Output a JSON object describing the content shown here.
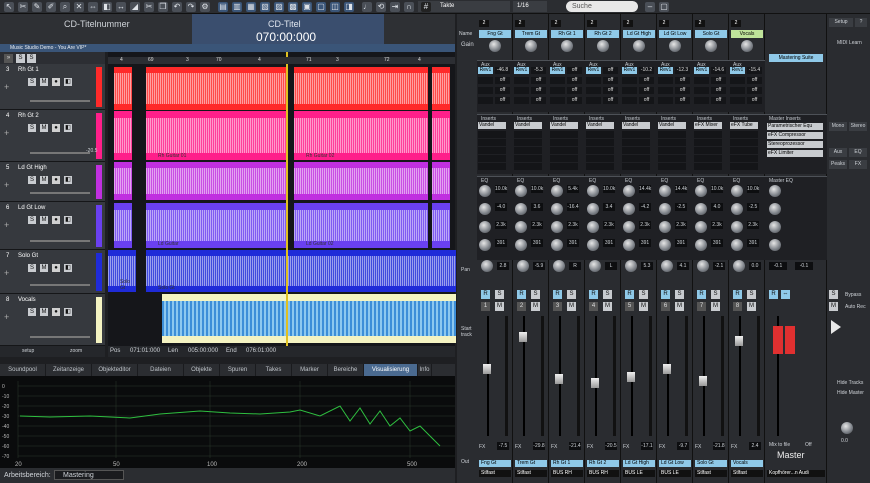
{
  "toolbar": {
    "tempo_label": "Takte",
    "grid": "1/16",
    "search_placeholder": "Suche"
  },
  "cd": {
    "track_label": "CD-Titelnummer",
    "title_label": "CD-Titel",
    "time": "070:00:000"
  },
  "project": {
    "name": "Music Studio Demo - You Are VIP*"
  },
  "tracks": [
    {
      "num": "3",
      "name": "Rh Gt 1",
      "color": "#ff2a2a"
    },
    {
      "num": "4",
      "name": "Rh Gt 2",
      "color": "#ff1f8a"
    },
    {
      "num": "5",
      "name": "Ld Gt High",
      "color": "#c030e0"
    },
    {
      "num": "6",
      "name": "Ld Gt Low",
      "color": "#6a40f0"
    },
    {
      "num": "7",
      "name": "Solo Gt",
      "color": "#1f2bd8"
    },
    {
      "num": "8",
      "name": "Vocals",
      "color": "#f4f3c2"
    }
  ],
  "track_btn": {
    "s": "S",
    "m": "M"
  },
  "track_vol": "-20.5",
  "ruler": {
    "marks": [
      "4",
      "69",
      "3",
      "70",
      "4",
      "71",
      "3",
      "72",
      "4"
    ]
  },
  "clips": {
    "rh_guitar": "Rh Guitar 01",
    "rh_guitar2": "Rh Guitar 02",
    "ld_guitar": "Ld Guitar",
    "ld_guitar2": "Ld Guitar 02",
    "solo": "Solo Gt",
    "solo2": "Solo Gt"
  },
  "zoom": {
    "setup": "setup",
    "zoom": "zoom"
  },
  "position": {
    "pos_label": "Pos",
    "pos_val": "071:01:000",
    "len_label": "Len",
    "len_val": "005:00:000",
    "end_label": "End",
    "end_val": "076:01:000"
  },
  "tabs": [
    "Soundpool",
    "Zeitanzeige",
    "Objekteditor",
    "Dateien",
    "Objekte",
    "Spuren",
    "Takes",
    "Marker",
    "Bereiche",
    "Visualisierung",
    "Info"
  ],
  "viz": {
    "x_ticks": [
      "20",
      "50",
      "100",
      "200",
      "500"
    ],
    "y_ticks": [
      "0",
      "-10",
      "-20",
      "-30",
      "-40",
      "-50",
      "-60",
      "-70"
    ]
  },
  "status": {
    "label": "Arbeitsbereich:",
    "value": "Mastering"
  },
  "mixer": {
    "name_label": "Name",
    "gain_label": "Gain",
    "aux_label": "Aux",
    "inserts_label": "Inserts",
    "eq_label": "EQ",
    "pan_label": "Pan",
    "start_label": "Start track",
    "out_label": "Out",
    "fx_label": "FX",
    "channels": [
      {
        "name": "Fng Gt",
        "vol": "-7.5",
        "out": "Stlfast",
        "pan": "2.8",
        "eq1": "10.0k",
        "eq2": "-4.0",
        "eq3": "2.3k",
        "eq4": "391",
        "aux1": "-46.8",
        "aux_sel": "Rev1",
        "out_num": "1"
      },
      {
        "name": "Trem Gt",
        "vol": "-29.8",
        "out": "Stlfast",
        "pan": "-5.9",
        "eq1": "10.0k",
        "eq2": "3.6",
        "eq3": "2.3k",
        "eq4": "391",
        "aux1": "-5.3",
        "aux_sel": "Rev1",
        "out_num": "2"
      },
      {
        "name": "Rh Gt 1",
        "vol": "-21.4",
        "out": "BUS RH",
        "pan": "R",
        "eq1": "5.4k",
        "eq2": "-16.4",
        "eq3": "2.3k",
        "eq4": "391",
        "aux1": "off",
        "aux_sel": "Rev1",
        "out_num": "3"
      },
      {
        "name": "Rh Gt 2",
        "vol": "-20.5",
        "out": "BUS RH",
        "pan": "L",
        "eq1": "10.0k",
        "eq2": "3.4",
        "eq3": "2.3k",
        "eq4": "391",
        "aux1": "off",
        "aux_sel": "Rev1",
        "out_num": "4"
      },
      {
        "name": "Ld Gt High",
        "vol": "-17.1",
        "out": "BUS LE",
        "pan": "5.3",
        "eq1": "14.4k",
        "eq2": "-4.2",
        "eq3": "2.3k",
        "eq4": "391",
        "aux1": "-10.2",
        "aux_sel": "Rev1",
        "out_num": "5"
      },
      {
        "name": "Ld Gt Low",
        "vol": "-9.7",
        "out": "BUS LE",
        "pan": "4.1",
        "eq1": "14.4k",
        "eq2": "-2.5",
        "eq3": "2.3k",
        "eq4": "391",
        "aux1": "-12.3",
        "aux_sel": "Rev1",
        "out_num": "6"
      },
      {
        "name": "Solo Gt",
        "vol": "-21.8",
        "out": "Stlfast",
        "pan": "-2.1",
        "eq1": "10.0k",
        "eq2": "4.0",
        "eq3": "2.3k",
        "eq4": "391",
        "aux1": "-14.6",
        "aux_sel": "Rev1",
        "out_num": "7"
      },
      {
        "name": "Vocals",
        "vol": "2.4",
        "out": "Stlfast",
        "pan": "0.0",
        "eq1": "10.0k",
        "eq2": "-2.5",
        "eq3": "2.3k",
        "eq4": "391",
        "aux1": "-15.4",
        "aux_sel": "Rev1",
        "out_num": "8"
      }
    ],
    "insert_names": [
      "Vandel",
      "Vandel",
      "Vandel",
      "Vandel",
      "Vandel",
      "Vandel",
      "eFX Mixer",
      "eFX Tube"
    ],
    "master": {
      "title": "Master",
      "suite": "Mastering Suite",
      "ins_label": "Master Inserts",
      "eq_label": "Master EQ",
      "inserts": [
        "Parametrischer Equ",
        "eFX Compressor",
        "Stereoprozessor",
        "eFX Limiter"
      ],
      "out": "Kopfhörer...n Audi",
      "pan": "-0.1",
      "pan2": "-0.1",
      "mix_label": "Mix to file",
      "off": "Off"
    },
    "side": {
      "setup": "Setup",
      "help": "?",
      "midi": "MIDI Learn",
      "mono": "Mono",
      "stereo": "Stereo",
      "aux": "Aux",
      "eq": "EQ",
      "fx": "FX",
      "peaks": "Peaks",
      "bypass": "Bypass",
      "auto_rec": "Auto Rec",
      "hide_tracks": "Hide Tracks",
      "hide_master": "Hide Master",
      "val": "0.0"
    }
  },
  "colors": {
    "accent": "#8fc9e8",
    "select": "#bfe39a",
    "red": "#ff2a2a"
  }
}
